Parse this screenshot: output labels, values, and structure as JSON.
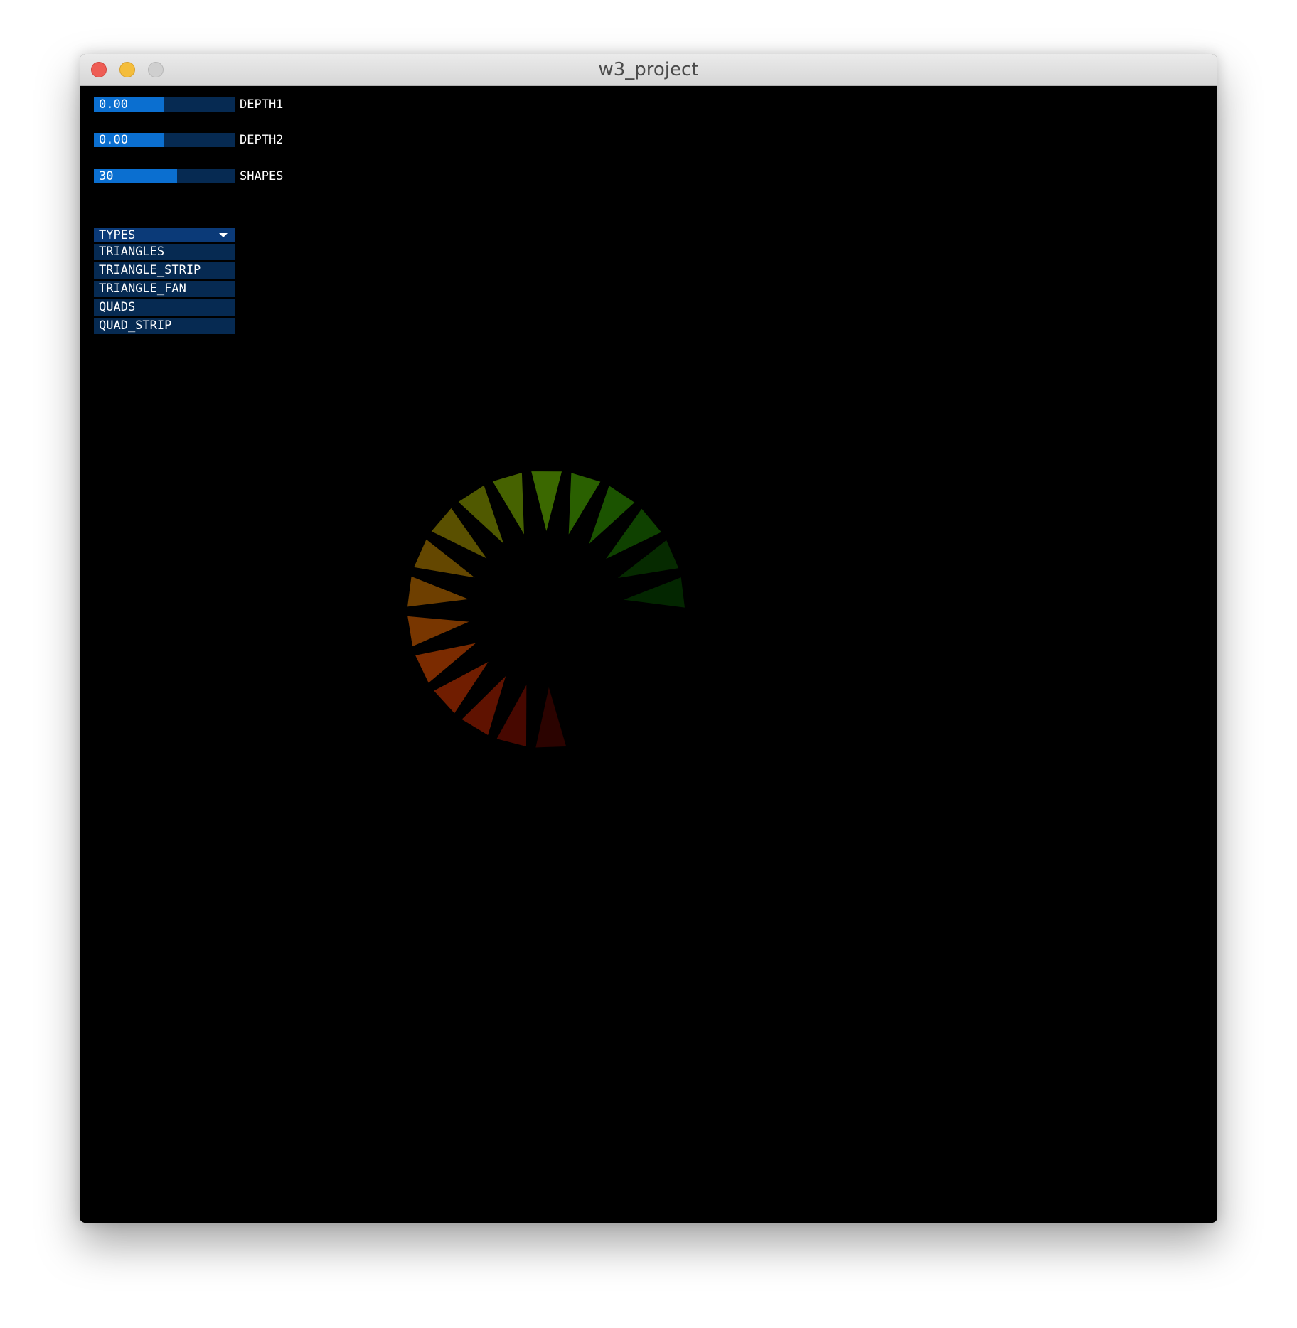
{
  "window": {
    "title": "w3_project"
  },
  "controls": {
    "depth1": {
      "value_text": "0.00",
      "label": "DEPTH1",
      "level": 0.5
    },
    "depth2": {
      "value_text": "0.00",
      "label": "DEPTH2",
      "level": 0.5
    },
    "shapes": {
      "value_text": "30",
      "label": "SHAPES",
      "level": 0.59
    }
  },
  "types_dropdown": {
    "label": "TYPES",
    "options": [
      "TRIANGLES",
      "TRIANGLE_STRIP",
      "TRIANGLE_FAN",
      "QUADS",
      "QUAD_STRIP"
    ]
  },
  "colors": {
    "slider_track": "#062a52",
    "slider_fill": "#0b6fd0",
    "dropdown_head": "#0b3a78",
    "canvas_bg": "#000000"
  },
  "scene": {
    "shape_type": "triangles",
    "visible_count": 17,
    "color_start": "red",
    "color_end": "green"
  }
}
